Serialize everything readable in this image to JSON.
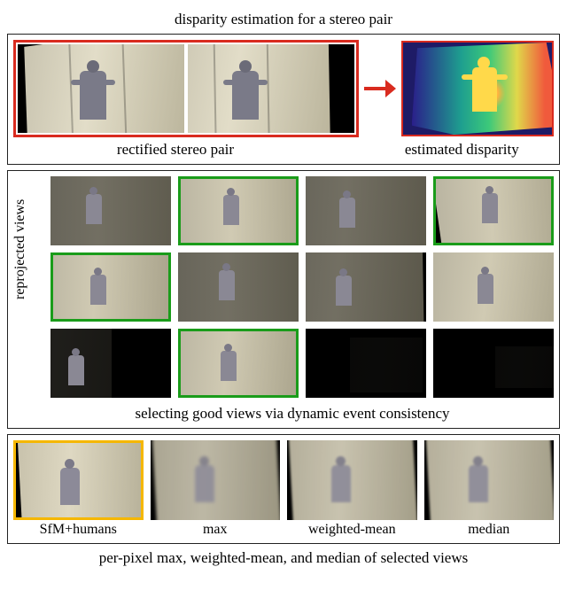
{
  "captions": {
    "top": "disparity estimation for a stereo pair",
    "stereo": "rectified stereo pair",
    "disparity": "estimated disparity",
    "mid_side": "reprojected views",
    "mid_bottom": "selecting good views via dynamic event consistency",
    "bottom": "per-pixel max, weighted-mean, and median of selected views"
  },
  "bottom_labels": [
    "SfM+humans",
    "max",
    "weighted-mean",
    "median"
  ],
  "colors": {
    "red": "#d92b1f",
    "green": "#1a9c1a",
    "yellow": "#f5b700"
  },
  "reprojected_grid": {
    "rows": 3,
    "cols": 4,
    "selected_indices": [
      1,
      3,
      4,
      9
    ]
  }
}
